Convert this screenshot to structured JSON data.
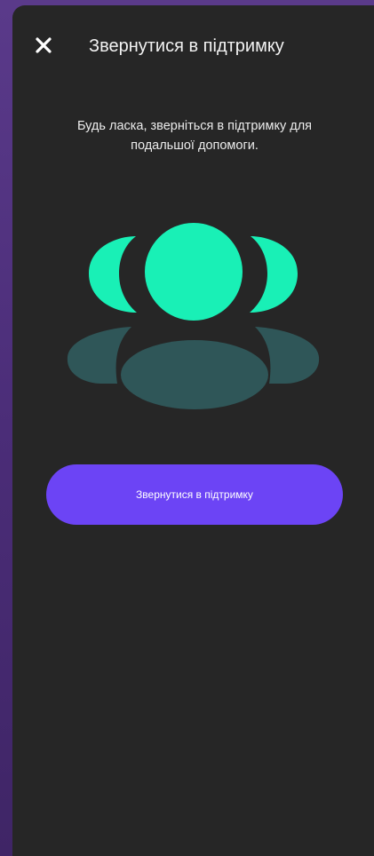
{
  "header": {
    "close_icon": "close-icon",
    "title": "Звернутися в підтримку"
  },
  "main": {
    "message": "Будь ласка, зверніться в підтримку для подальшої допомоги.",
    "illustration_icon": "support-team-icon",
    "button_label": "Звернутися в підтримку"
  },
  "colors": {
    "frame": "#4b2d78",
    "background": "#262626",
    "accent_green": "#19f0b6",
    "teal_dark": "#2f5658",
    "button": "#6c44f5",
    "text": "#f2f2f2"
  }
}
